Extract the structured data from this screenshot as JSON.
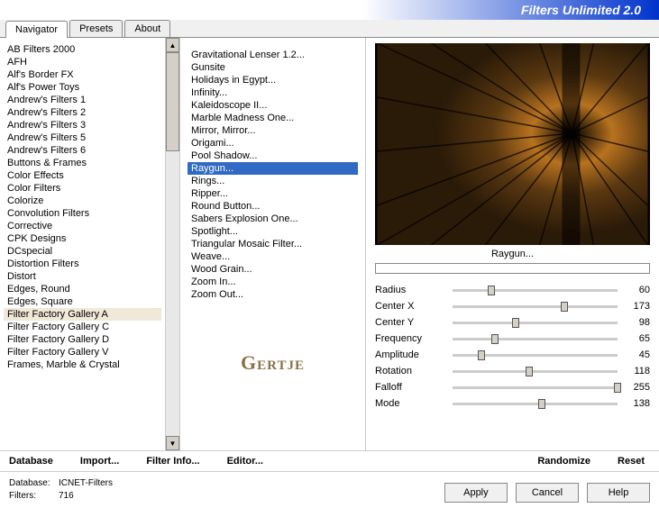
{
  "header": {
    "title": "Filters Unlimited 2.0"
  },
  "tabs": [
    "Navigator",
    "Presets",
    "About"
  ],
  "activeTab": 0,
  "leftList": {
    "items": [
      "AB Filters 2000",
      "AFH",
      "Alf's Border FX",
      "Alf's Power Toys",
      "Andrew's Filters 1",
      "Andrew's Filters 2",
      "Andrew's Filters 3",
      "Andrew's Filters 5",
      "Andrew's Filters 6",
      "Buttons & Frames",
      "Color Effects",
      "Color Filters",
      "Colorize",
      "Convolution Filters",
      "Corrective",
      "CPK Designs",
      "DCspecial",
      "Distortion Filters",
      "Distort",
      "Edges, Round",
      "Edges, Square",
      "Filter Factory Gallery A",
      "Filter Factory Gallery C",
      "Filter Factory Gallery D",
      "Filter Factory Gallery V",
      "Frames, Marble & Crystal"
    ],
    "selectedIndex": 21
  },
  "midList": {
    "items": [
      "Gravitational Lenser 1.2...",
      "Gunsite",
      "Holidays in Egypt...",
      "Infinity...",
      "Kaleidoscope II...",
      "Marble Madness One...",
      "Mirror, Mirror...",
      "Origami...",
      "Pool Shadow...",
      "Raygun...",
      "Rings...",
      "Ripper...",
      "Round Button...",
      "Sabers Explosion One...",
      "Spotlight...",
      "Triangular Mosaic Filter...",
      "Weave...",
      "Wood Grain...",
      "Zoom In...",
      "Zoom Out..."
    ],
    "selectedIndex": 9
  },
  "watermark": "Gertje",
  "preview": {
    "label": "Raygun..."
  },
  "params": [
    {
      "label": "Radius",
      "value": 60,
      "max": 255
    },
    {
      "label": "Center X",
      "value": 173,
      "max": 255
    },
    {
      "label": "Center Y",
      "value": 98,
      "max": 255
    },
    {
      "label": "Frequency",
      "value": 65,
      "max": 255
    },
    {
      "label": "Amplitude",
      "value": 45,
      "max": 255
    },
    {
      "label": "Rotation",
      "value": 118,
      "max": 255
    },
    {
      "label": "Falloff",
      "value": 255,
      "max": 255
    },
    {
      "label": "Mode",
      "value": 138,
      "max": 255
    }
  ],
  "toolbar": {
    "database": "Database",
    "import": "Import...",
    "filterInfo": "Filter Info...",
    "editor": "Editor...",
    "randomize": "Randomize",
    "reset": "Reset"
  },
  "footer": {
    "dbLabel": "Database:",
    "dbValue": "ICNET-Filters",
    "filtersLabel": "Filters:",
    "filtersValue": "716",
    "apply": "Apply",
    "cancel": "Cancel",
    "help": "Help"
  }
}
